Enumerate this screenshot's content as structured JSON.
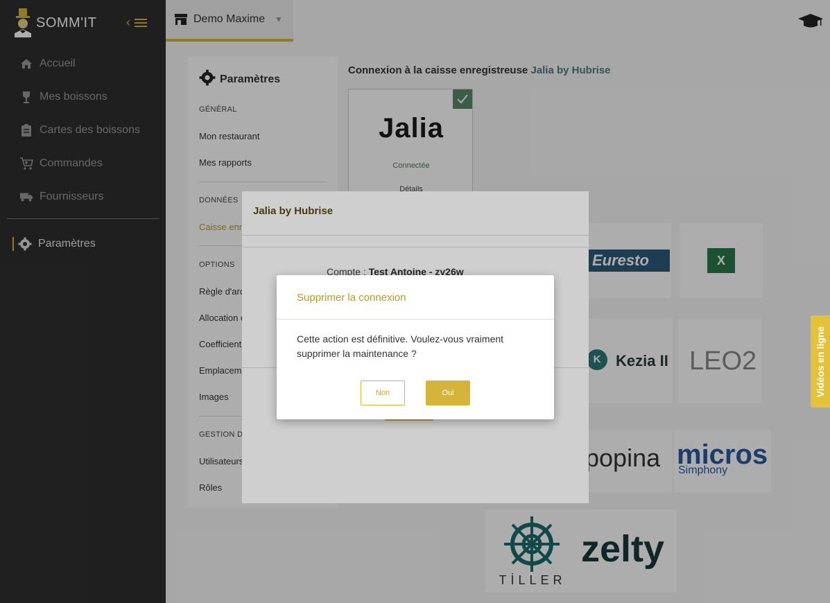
{
  "app": {
    "name": "SOMM'IT"
  },
  "sidebar": {
    "items": [
      {
        "label": "Accueil",
        "icon": "home-icon"
      },
      {
        "label": "Mes boissons",
        "icon": "wine-glass-icon"
      },
      {
        "label": "Cartes des boissons",
        "icon": "clipboard-icon"
      },
      {
        "label": "Commandes",
        "icon": "cart-icon"
      },
      {
        "label": "Fournisseurs",
        "icon": "truck-icon"
      }
    ],
    "active": {
      "label": "Paramètres",
      "icon": "gear-icon"
    }
  },
  "topbar": {
    "store": "Demo Maxime"
  },
  "settings": {
    "title": "Paramètres",
    "general": "GÉNÉRAL",
    "mon_restaurant": "Mon restaurant",
    "mes_rapports": "Mes rapports",
    "donnees": "DONNÉES",
    "caisse": "Caisse enre",
    "options": "OPTIONS",
    "regle": "Règle d'arc",
    "allocation": "Allocation c",
    "coefficient": "Coefficient",
    "emplacement": "Emplaceme",
    "images": "Images",
    "gestion": "GESTION DU",
    "utilisateurs": "Utilisateurs",
    "roles": "Rôles"
  },
  "main": {
    "title_prefix": "Connexion à la caisse enregistreuse",
    "title_brand": "Jalia by Hubrise",
    "card": {
      "logo": "Jalia",
      "status": "Connectée",
      "details": "Détails"
    },
    "brands": {
      "euresto": "Euresto",
      "kezia": "Kezia II",
      "kezia_mark": "K",
      "leo2": "LEO2",
      "popina": "popina",
      "micros": "micros",
      "simphony": "Simphony",
      "tiller": "TİLLER",
      "zelty": "zelty",
      "excel_mark": "X"
    }
  },
  "modal": {
    "title": "Jalia by Hubrise",
    "account_prefix": "Compte :",
    "account_value": "Test Antoine - zy26w"
  },
  "dialog": {
    "title": "Supprimer la connexion",
    "message": "Cette action est définitive. Voulez-vous vraiment supprimer la maintenance ?",
    "cancel": "Non",
    "confirm": "Oui"
  },
  "videos_tab": "Vidéos en ligne",
  "colors": {
    "accent": "#d4b53a",
    "sidebar": "#2f2f2f"
  }
}
